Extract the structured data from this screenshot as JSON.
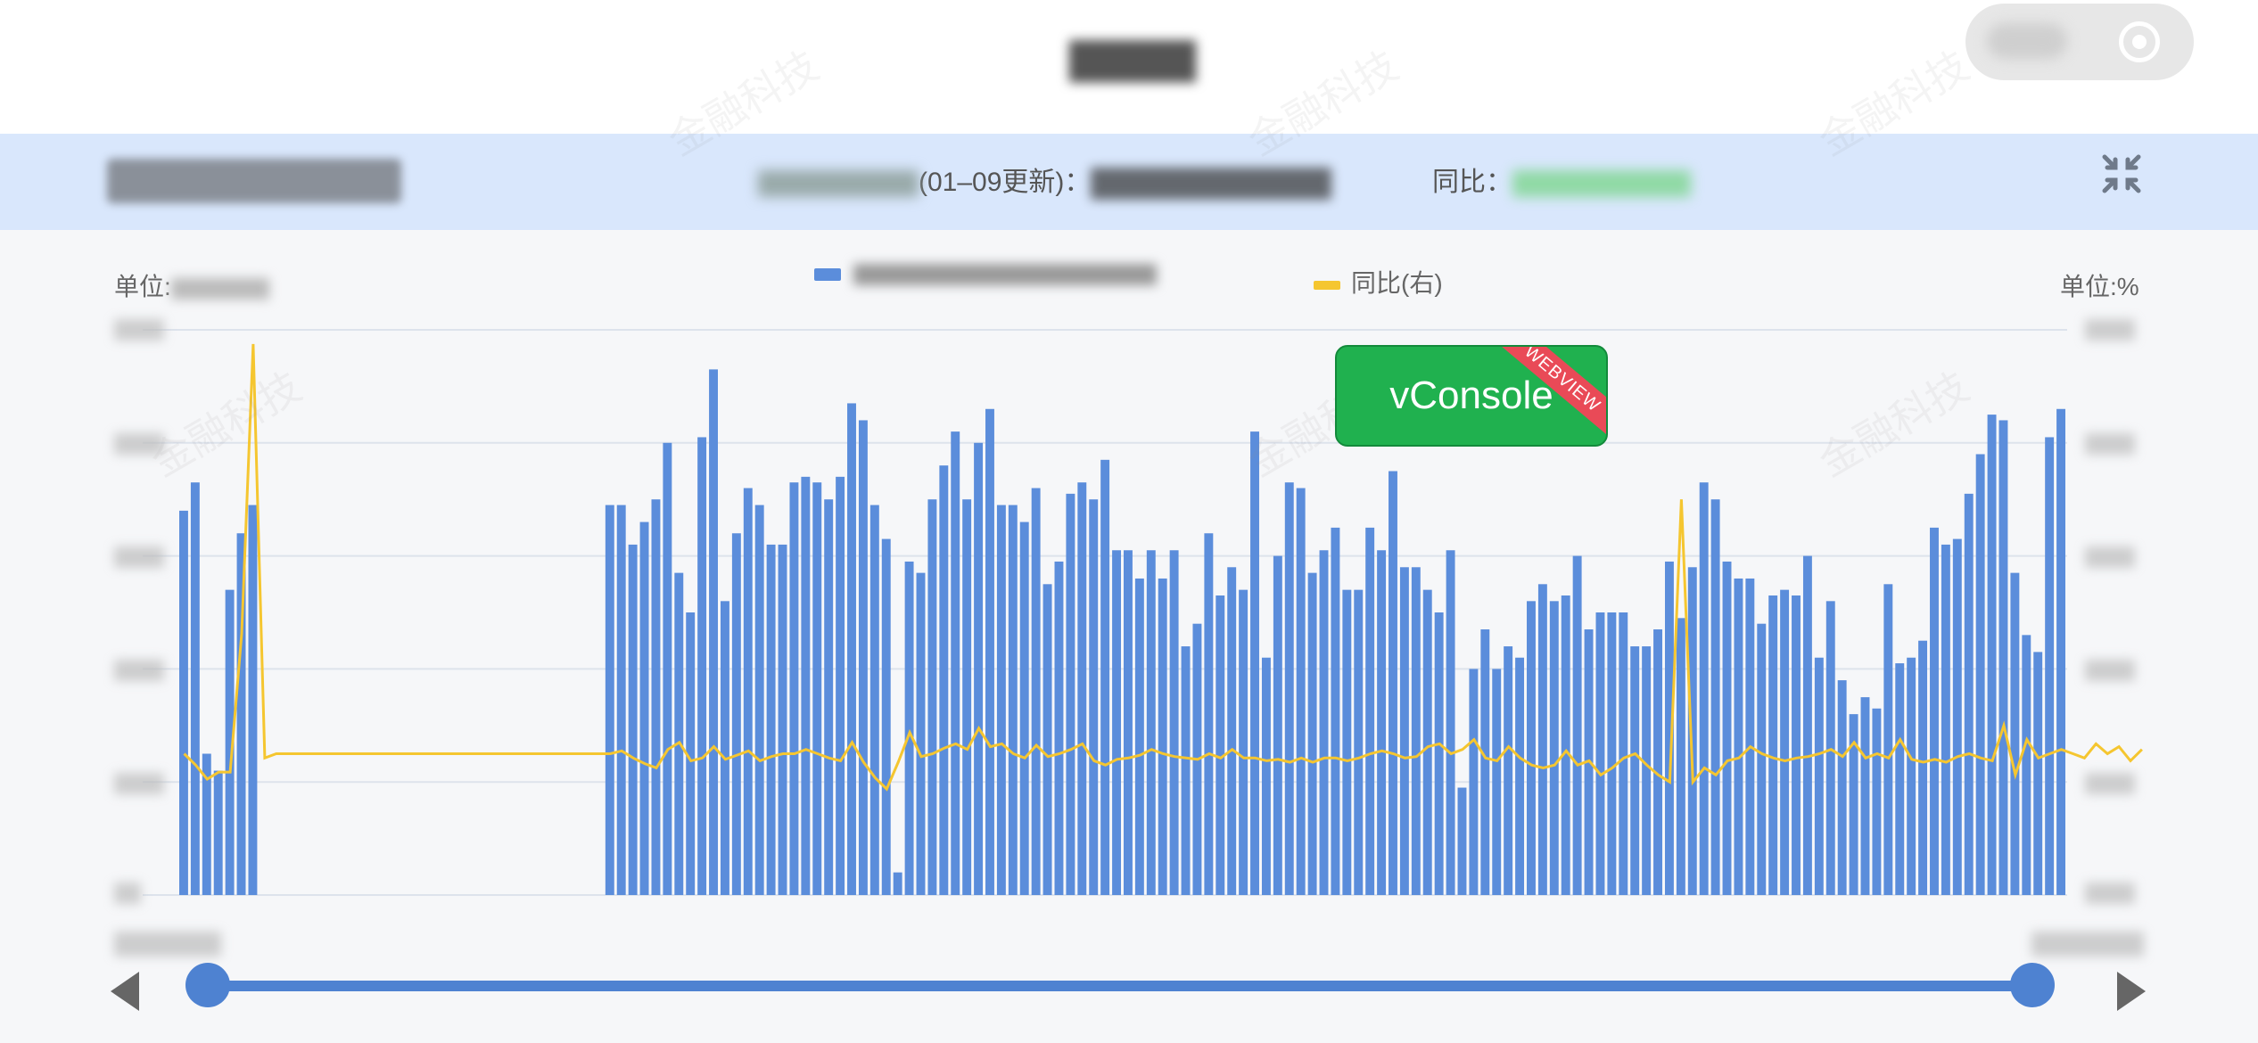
{
  "title_bar": {
    "capsule_icons": [
      "more-icon",
      "target-icon"
    ]
  },
  "info_bar": {
    "update_text": "(01–09更新)：",
    "yoy_label": "同比："
  },
  "chart_labels": {
    "unit_left": "单位:",
    "unit_right": "单位:%",
    "legend_line": "同比(右)"
  },
  "vconsole": {
    "label": "vConsole",
    "badge": "WEBVIEW"
  },
  "watermark_text": "金融科技",
  "colors": {
    "bar": "#5b8ddb",
    "line": "#f5c630",
    "slider": "#4e82d1",
    "vconsole": "#20b14f",
    "header": "#d9e7fc"
  },
  "chart_data": {
    "type": "bar",
    "y_left_range": [
      0,
      100
    ],
    "y_right_range": [
      -100,
      300
    ],
    "grid": true,
    "series": [
      {
        "type": "bar",
        "axis": "left",
        "values": [
          68,
          73,
          25,
          22,
          54,
          64,
          69,
          0,
          0,
          0,
          0,
          0,
          0,
          0,
          0,
          0,
          0,
          0,
          0,
          0,
          0,
          0,
          0,
          0,
          0,
          0,
          0,
          0,
          0,
          0,
          0,
          0,
          0,
          0,
          0,
          0,
          0,
          69,
          69,
          62,
          66,
          70,
          80,
          57,
          50,
          81,
          93,
          52,
          64,
          72,
          69,
          62,
          62,
          73,
          74,
          73,
          70,
          74,
          87,
          84,
          69,
          63,
          4,
          59,
          57,
          70,
          76,
          82,
          70,
          80,
          86,
          69,
          69,
          66,
          72,
          55,
          59,
          71,
          73,
          70,
          77,
          61,
          61,
          56,
          61,
          56,
          61,
          44,
          48,
          64,
          53,
          58,
          54,
          82,
          42,
          60,
          73,
          72,
          57,
          61,
          65,
          54,
          54,
          65,
          61,
          75,
          58,
          58,
          54,
          50,
          61,
          19,
          40,
          47,
          40,
          44,
          42,
          52,
          55,
          52,
          53,
          60,
          47,
          50,
          50,
          50,
          44,
          44,
          47,
          59,
          49,
          58,
          73,
          70,
          59,
          56,
          56,
          48,
          53,
          54,
          53,
          60,
          42,
          52,
          38,
          32,
          35,
          33,
          55,
          41,
          42,
          45,
          65,
          62,
          63,
          71,
          78,
          85,
          84,
          57,
          46,
          43,
          81,
          86
        ],
        "name": ""
      },
      {
        "type": "line",
        "axis": "right",
        "name": "同比(右)",
        "values": [
          0,
          -8,
          -18,
          -13,
          -13,
          85,
          290,
          -3,
          0,
          0,
          0,
          0,
          0,
          0,
          0,
          0,
          0,
          0,
          0,
          0,
          0,
          0,
          0,
          0,
          0,
          0,
          0,
          0,
          0,
          0,
          0,
          0,
          0,
          0,
          0,
          0,
          0,
          0,
          2,
          -3,
          -7,
          -10,
          3,
          8,
          -5,
          -3,
          5,
          -4,
          -1,
          2,
          -5,
          -2,
          0,
          0,
          3,
          0,
          -3,
          -5,
          8,
          -6,
          -17,
          -25,
          -6,
          15,
          -2,
          0,
          4,
          7,
          3,
          18,
          5,
          7,
          0,
          -3,
          6,
          -2,
          0,
          3,
          7,
          -5,
          -8,
          -4,
          -3,
          -1,
          3,
          0,
          -2,
          -3,
          -4,
          0,
          -3,
          3,
          -3,
          -3,
          -5,
          -4,
          -6,
          -3,
          -6,
          -3,
          -3,
          -5,
          -3,
          0,
          2,
          0,
          -3,
          -2,
          5,
          7,
          0,
          3,
          10,
          -3,
          -5,
          5,
          -3,
          -8,
          -10,
          -8,
          2,
          -8,
          -5,
          -15,
          -10,
          -3,
          0,
          -8,
          -15,
          -20,
          180,
          -20,
          -10,
          -15,
          -5,
          -3,
          5,
          0,
          -3,
          -5,
          -3,
          -2,
          0,
          3,
          -2,
          8,
          -3,
          0,
          -3,
          10,
          -4,
          -6,
          -4,
          -6,
          -2,
          0,
          -3,
          -5,
          20,
          -15,
          10,
          -3,
          0,
          3,
          0,
          -3,
          7,
          0,
          5,
          -5,
          3
        ]
      }
    ]
  }
}
